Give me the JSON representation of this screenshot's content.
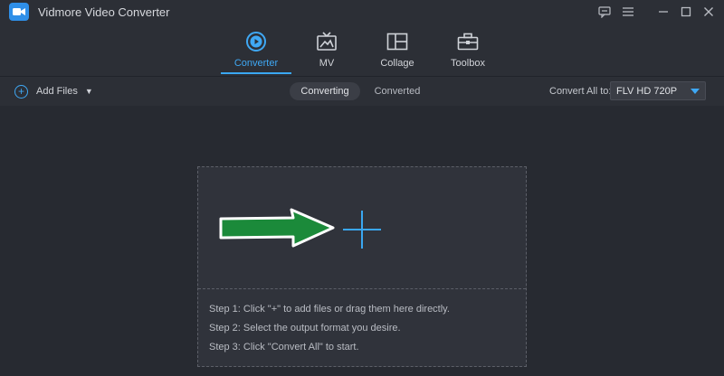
{
  "window": {
    "title": "Vidmore Video Converter",
    "logo_icon": "video-camera-logo-icon",
    "controls": [
      "feedback-icon",
      "menu-icon",
      "minimize-icon",
      "maximize-icon",
      "close-icon"
    ]
  },
  "nav": {
    "tabs": [
      {
        "label": "Converter",
        "icon": "converter-icon",
        "active": true
      },
      {
        "label": "MV",
        "icon": "mv-icon",
        "active": false
      },
      {
        "label": "Collage",
        "icon": "collage-icon",
        "active": false
      },
      {
        "label": "Toolbox",
        "icon": "toolbox-icon",
        "active": false
      }
    ],
    "accent": "#3aa7f2"
  },
  "toolbar": {
    "add_files_label": "Add Files",
    "segments": {
      "converting": "Converting",
      "converted": "Converted"
    },
    "convert_all_label": "Convert All to:",
    "format_value": "FLV HD 720P"
  },
  "dropzone": {
    "steps": [
      "Step 1: Click \"+\" to add files or drag them here directly.",
      "Step 2: Select the output format you desire.",
      "Step 3: Click \"Convert All\" to start."
    ],
    "arrow_color": "#1b8a3a"
  }
}
